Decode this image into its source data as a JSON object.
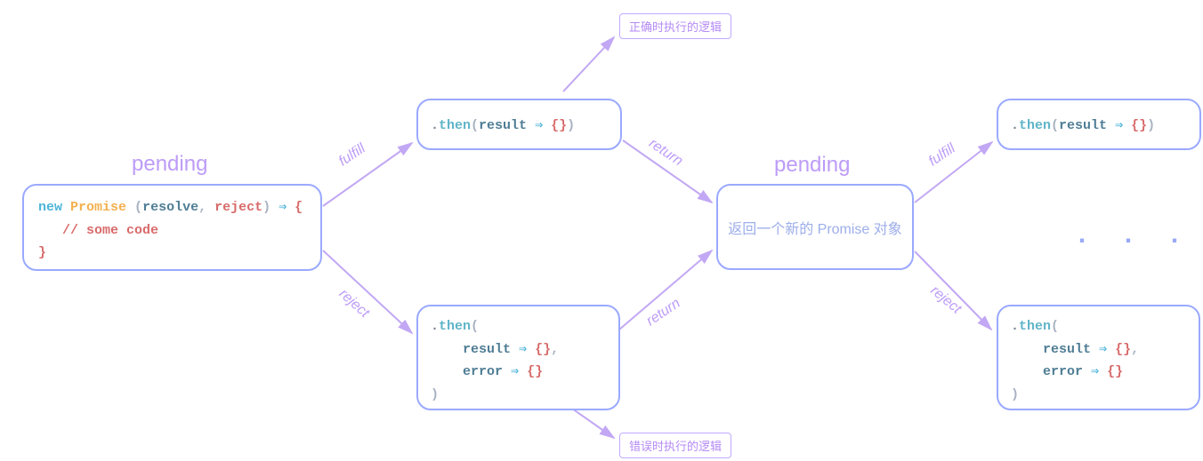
{
  "titles": {
    "pending1": "pending",
    "pending2": "pending"
  },
  "boxes": {
    "newPromise": {
      "kw_new": "new",
      "cls": "Promise",
      "open": " (",
      "arg1": "resolve",
      "comma": ", ",
      "arg2": "reject",
      "close": ")",
      "arrow": " ⇒ ",
      "brace_open": "{",
      "comment": "// some code",
      "brace_close": "}"
    },
    "thenResult": {
      "dot": ".",
      "method": "then",
      "open": "(",
      "arg": "result",
      "arrow": " ⇒ ",
      "body": "{}",
      "close": ")"
    },
    "thenResultError": {
      "dot": ".",
      "method": "then",
      "open": "(",
      "arg1": "result",
      "arrow1": " ⇒ ",
      "body1": "{}",
      "sep": ",",
      "arg2": "error",
      "arrow2": " ⇒ ",
      "body2": "{}",
      "close": ")"
    },
    "returnPromise": "返回一个新的 Promise 对象",
    "correctLogic": "正确时执行的逻辑",
    "errorLogic": "错误时执行的逻辑",
    "ellipsis": ". . ."
  },
  "labels": {
    "fulfill1": "fulfill",
    "reject1": "reject",
    "return1": "return",
    "return2": "return",
    "fulfill2": "fulfill",
    "reject2": "reject"
  }
}
